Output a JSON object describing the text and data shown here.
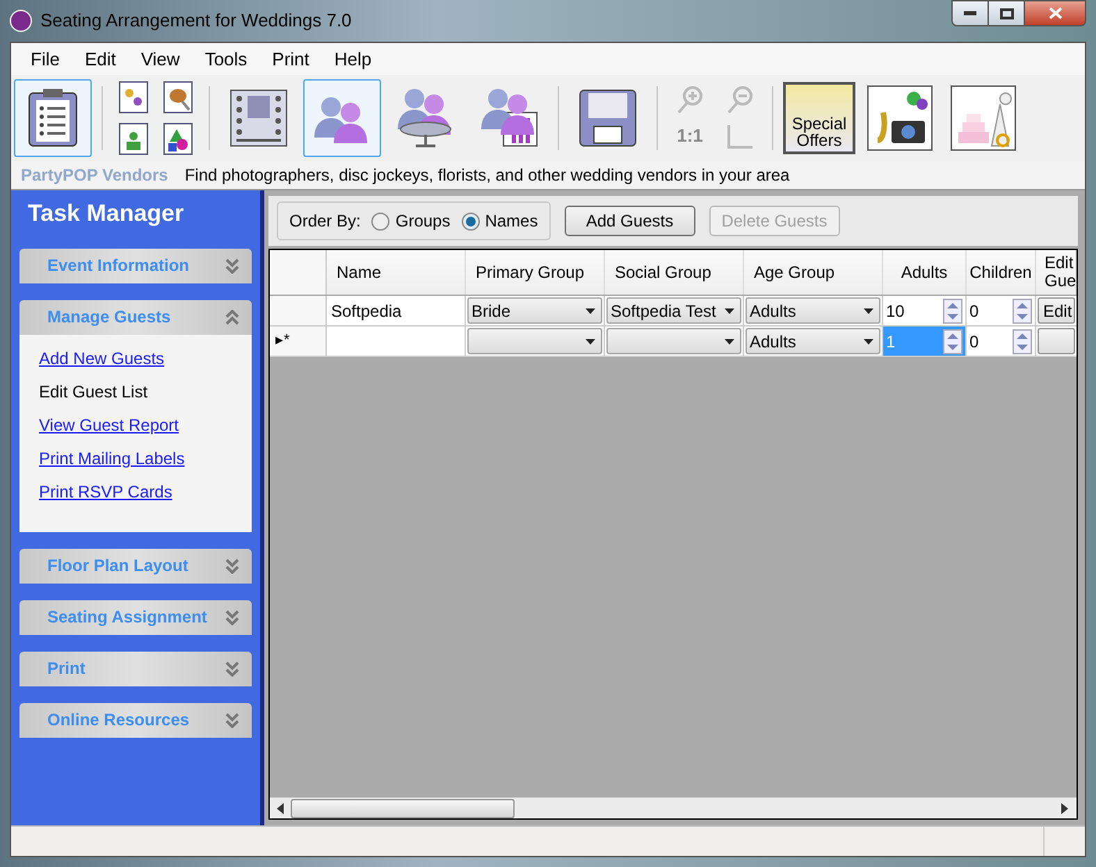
{
  "window": {
    "title": "Seating Arrangement for Weddings 7.0"
  },
  "menu": [
    "File",
    "Edit",
    "View",
    "Tools",
    "Print",
    "Help"
  ],
  "toolbar": [
    {
      "kind": "tool",
      "selected": true
    },
    {
      "kind": "separator"
    },
    {
      "kind": "quad"
    },
    {
      "kind": "separator"
    },
    {
      "kind": "tool",
      "selected": false
    },
    {
      "kind": "tool",
      "selected": true
    },
    {
      "kind": "tool",
      "selected": false
    },
    {
      "kind": "tool",
      "selected": false
    },
    {
      "kind": "separator"
    },
    {
      "kind": "tool",
      "selected": false
    },
    {
      "kind": "separator"
    },
    {
      "kind": "zoom",
      "disabled": true,
      "label": "1:1"
    },
    {
      "kind": "separator"
    },
    {
      "kind": "offer",
      "selected": false,
      "label": "Special Offers"
    },
    {
      "kind": "tool",
      "selected": false
    },
    {
      "kind": "tool",
      "selected": false
    }
  ],
  "vendor_bar": {
    "brand": "PartyPOP Vendors",
    "text": "Find photographers, disc jockeys, florists, and other wedding vendors in your area"
  },
  "sidebar": {
    "title": "Task Manager",
    "sections": [
      {
        "title": "Event Information",
        "expanded": false
      },
      {
        "title": "Manage Guests",
        "expanded": true,
        "links": [
          {
            "label": "Add New Guests",
            "selected": false
          },
          {
            "label": "Edit Guest List",
            "selected": true
          },
          {
            "label": "View Guest Report",
            "selected": false
          },
          {
            "label": "Print Mailing Labels",
            "selected": false
          },
          {
            "label": "Print RSVP Cards",
            "selected": false
          }
        ]
      },
      {
        "title": "Floor Plan Layout",
        "expanded": false
      },
      {
        "title": "Seating Assignment",
        "expanded": false
      },
      {
        "title": "Print",
        "expanded": false
      },
      {
        "title": "Online Resources",
        "expanded": false
      }
    ]
  },
  "guests": {
    "order_by": "Order By:",
    "radios": [
      {
        "label": "Groups",
        "selected": false
      },
      {
        "label": "Names",
        "selected": true
      }
    ],
    "buttons": [
      {
        "label": "Add Guests",
        "disabled": false
      },
      {
        "label": "Delete Guests",
        "disabled": true
      }
    ],
    "columns": [
      "Name",
      "Primary Group",
      "Social Group",
      "Age Group",
      "Adults",
      "Children",
      "Edit Gue"
    ],
    "rows": [
      {
        "marker": "",
        "cells": [
          {
            "kind": "text",
            "value": "Softpedia"
          },
          {
            "kind": "combo",
            "value": "Bride"
          },
          {
            "kind": "combo",
            "value": "Softpedia Test"
          },
          {
            "kind": "combo",
            "value": "Adults"
          },
          {
            "kind": "spin",
            "value": "10",
            "selected": false
          },
          {
            "kind": "spin",
            "value": "0",
            "selected": false
          },
          {
            "kind": "button",
            "value": "Edit"
          }
        ]
      },
      {
        "marker": "▸*",
        "cells": [
          {
            "kind": "text"
          },
          {
            "kind": "combo"
          },
          {
            "kind": "combo"
          },
          {
            "kind": "combo",
            "value": "Adults"
          },
          {
            "kind": "spin",
            "value": "1",
            "selected": true
          },
          {
            "kind": "spin",
            "value": "0",
            "selected": false
          },
          {
            "kind": "button"
          }
        ]
      }
    ]
  }
}
